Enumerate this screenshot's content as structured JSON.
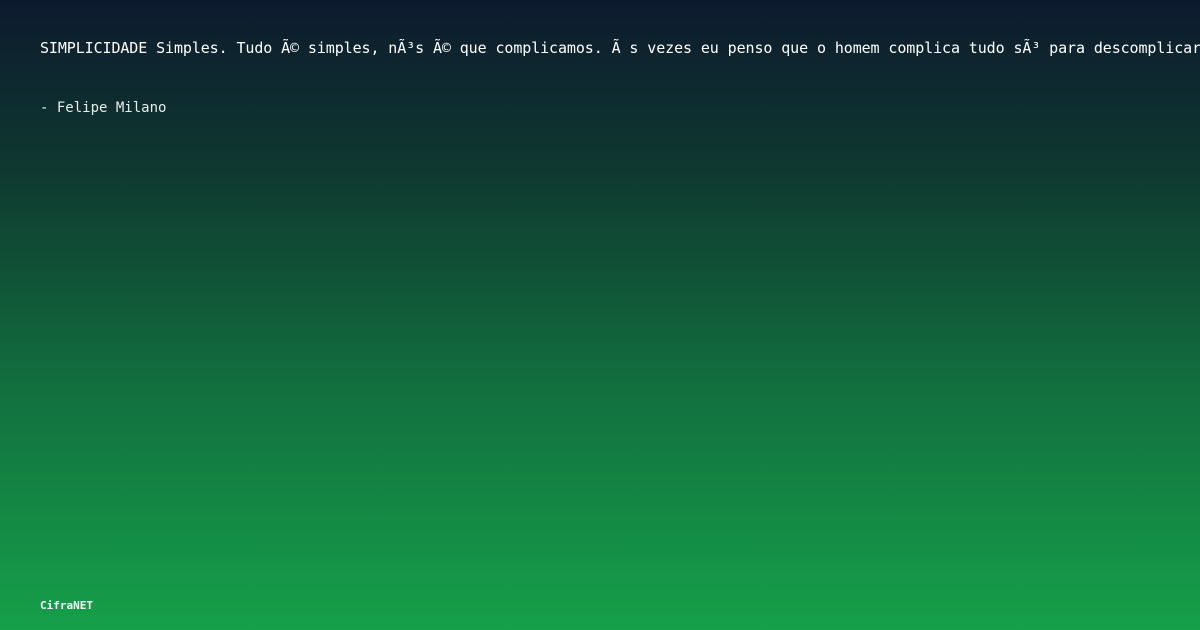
{
  "quote": {
    "text": "SIMPLICIDADE Simples. Tudo Ã© simples, nÃ³s Ã© que complicamos. Ã s vezes eu penso que o homem complica tudo sÃ³ para descomplicar",
    "author": "- Felipe Milano"
  },
  "brand": {
    "name": "CifraNET"
  }
}
